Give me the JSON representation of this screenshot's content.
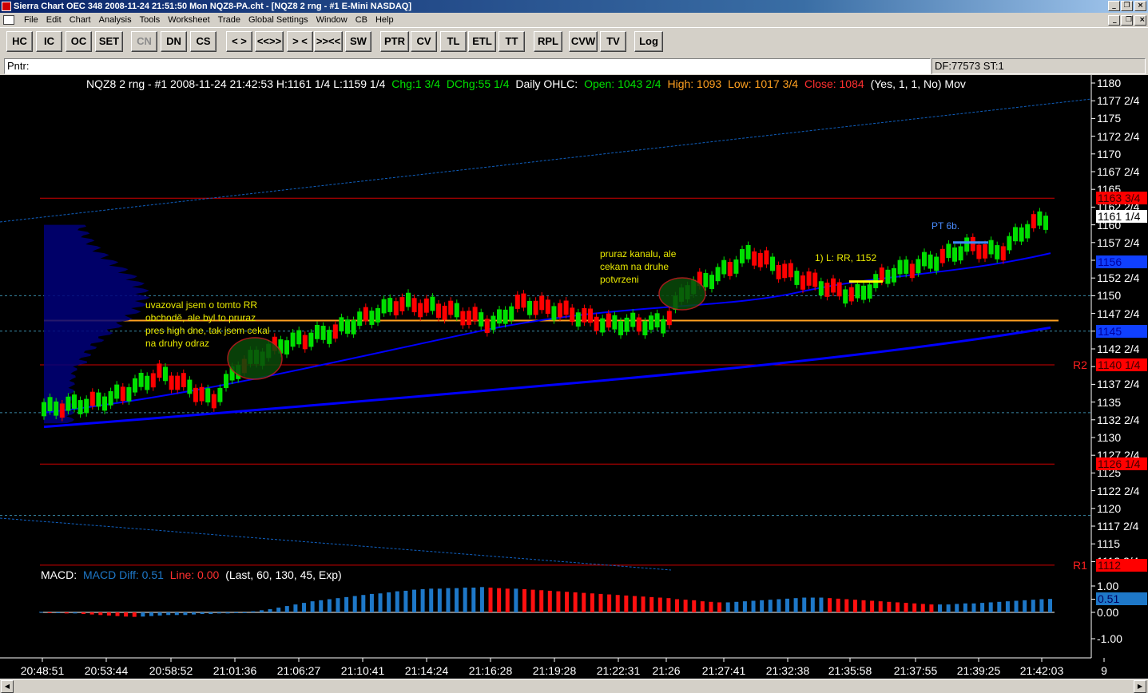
{
  "window": {
    "title": "Sierra Chart OEC 348  2008-11-24  21:51:50  Mon   NQZ8-PA.cht - [NQZ8  2 rng - #1 E-Mini NASDAQ]"
  },
  "menu": [
    "File",
    "Edit",
    "Chart",
    "Analysis",
    "Tools",
    "Worksheet",
    "Trade",
    "Global Settings",
    "Window",
    "CB",
    "Help"
  ],
  "toolbar": [
    {
      "label": "HC",
      "enabled": true
    },
    {
      "label": "IC",
      "enabled": true
    },
    {
      "label": "OC",
      "enabled": true
    },
    {
      "label": "SET",
      "enabled": true
    },
    {
      "label": "CN",
      "enabled": false
    },
    {
      "label": "DN",
      "enabled": true
    },
    {
      "label": "CS",
      "enabled": true
    },
    {
      "label": "< >",
      "enabled": true
    },
    {
      "label": "<<>>",
      "enabled": true
    },
    {
      "label": "> <",
      "enabled": true
    },
    {
      "label": ">><<",
      "enabled": true
    },
    {
      "label": "SW",
      "enabled": true
    },
    {
      "label": "PTR",
      "enabled": true
    },
    {
      "label": "CV",
      "enabled": true
    },
    {
      "label": "TL",
      "enabled": true
    },
    {
      "label": "ETL",
      "enabled": true
    },
    {
      "label": "TT",
      "enabled": true
    },
    {
      "label": "RPL",
      "enabled": true
    },
    {
      "label": "CVW",
      "enabled": true
    },
    {
      "label": "TV",
      "enabled": true
    },
    {
      "label": "Log",
      "enabled": true
    }
  ],
  "pointer": {
    "label": "Pntr:",
    "status": "DF:77573  ST:1"
  },
  "header": {
    "symbol": "NQZ8  2 rng - #1  2008-11-24  21:42:53  H:1161 1/4  L:1159 1/4",
    "chg": "Chg:1 3/4",
    "dchg": "DChg:55 1/4",
    "ohlc_label": "Daily OHLC:",
    "open": "Open: 1043 2/4",
    "high": "High: 1093",
    "low": "Low: 1017 3/4",
    "close": "Close: 1084",
    "extra": "(Yes, 1, 1, No)  Mov"
  },
  "colors": {
    "up": "#00e000",
    "down": "#ff0000",
    "ma": "#0000ff",
    "macd_blue": "#1e78c8",
    "macd_red": "#ff1010",
    "level": "#d00000",
    "orange": "#ffa020"
  },
  "price_axis": {
    "labels": [
      "1180",
      "1177 2/4",
      "1175",
      "1172 2/4",
      "1170",
      "1167 2/4",
      "1165",
      "1162 2/4",
      "1160",
      "1157 2/4",
      "1155",
      "1152 2/4",
      "1150",
      "1147 2/4",
      "1145",
      "1142 2/4",
      "1140",
      "1137 2/4",
      "1135",
      "1132 2/4",
      "1130",
      "1127 2/4",
      "1125",
      "1122 2/4",
      "1120",
      "1117 2/4",
      "1115",
      "1112 2/4"
    ],
    "tags": [
      {
        "text": "1163 3/4",
        "price": 1163.75,
        "bg": "#ff0000",
        "fg": "#400000"
      },
      {
        "text": "1161 1/4",
        "price": 1161.25,
        "bg": "#ffffff",
        "fg": "#000000"
      },
      {
        "text": "1156",
        "price": 1154.75,
        "bg": "#1040ff",
        "fg": "#0000a0"
      },
      {
        "text": "1145",
        "price": 1145.0,
        "bg": "#1040ff",
        "fg": "#0000a0"
      },
      {
        "text": "1140 1/4",
        "price": 1140.25,
        "bg": "#ff0000",
        "fg": "#400000"
      },
      {
        "text": "1126 1/4",
        "price": 1126.25,
        "bg": "#ff0000",
        "fg": "#400000"
      },
      {
        "text": "1112",
        "price": 1112.0,
        "bg": "#ff0000",
        "fg": "#400000"
      }
    ],
    "level_names": [
      {
        "text": "R2",
        "price": 1140.25
      },
      {
        "text": "R1",
        "price": 1112.0
      }
    ]
  },
  "macd_axis": {
    "labels": [
      "1.00",
      "0.50",
      "0.00",
      "-1.00"
    ],
    "tag": "0.51"
  },
  "macd": {
    "label": "MACD:",
    "diff": "MACD Diff: 0.51",
    "line": "Line: 0.00",
    "params": "(Last, 60, 130, 45, Exp)"
  },
  "time_axis": [
    "20:48:51",
    "20:53:44",
    "20:58:52",
    "21:01:36",
    "21:06:27",
    "21:10:41",
    "21:14:24",
    "21:16:28",
    "21:19:28",
    "21:22:31",
    "21:26",
    "21:27:41",
    "21:32:38",
    "21:35:58",
    "21:37:55",
    "21:39:25",
    "21:42:03",
    "9"
  ],
  "annotations": [
    {
      "text": "uvazoval jsem o tomto RR\nobchodě, ale byl to pruraz\npres high dne, tak jsem cekal\nna druhy odraz"
    },
    {
      "text": "pruraz kanalu, ale\ncekam na druhe\npotvrzeni"
    },
    {
      "text": "1) L: RR, 1152"
    },
    {
      "text": "PT 6b."
    }
  ],
  "chart_data": {
    "type": "candlestick",
    "levels": [
      1163.75,
      1140.25,
      1126.25,
      1112.0
    ],
    "dotted_levels": [
      1150.0,
      1145.0,
      1133.5,
      1119.0
    ],
    "orange_level": 1146.5,
    "macd_hist": [
      0.02,
      -0.02,
      -0.02,
      -0.04,
      -0.04,
      -0.06,
      -0.08,
      -0.1,
      -0.12,
      -0.14,
      -0.16,
      -0.17,
      -0.16,
      -0.14,
      -0.12,
      -0.1,
      -0.1,
      -0.1,
      -0.08,
      -0.06,
      -0.06,
      -0.04,
      -0.04,
      -0.02,
      0.0,
      0.04,
      0.08,
      0.12,
      0.18,
      0.24,
      0.3,
      0.36,
      0.42,
      0.46,
      0.5,
      0.54,
      0.58,
      0.62,
      0.66,
      0.7,
      0.72,
      0.76,
      0.8,
      0.82,
      0.86,
      0.88,
      0.9,
      0.9,
      0.92,
      0.92,
      0.94,
      0.94,
      0.96,
      0.94,
      0.92,
      0.9,
      0.9,
      0.88,
      0.86,
      0.84,
      0.82,
      0.8,
      0.78,
      0.76,
      0.74,
      0.72,
      0.7,
      0.68,
      0.66,
      0.64,
      0.62,
      0.6,
      0.58,
      0.56,
      0.54,
      0.5,
      0.48,
      0.46,
      0.42,
      0.4,
      0.38,
      0.38,
      0.4,
      0.42,
      0.44,
      0.46,
      0.48,
      0.5,
      0.52,
      0.54,
      0.56,
      0.56,
      0.56,
      0.54,
      0.52,
      0.5,
      0.48,
      0.46,
      0.44,
      0.42,
      0.4,
      0.38,
      0.36,
      0.34,
      0.32,
      0.3,
      0.3,
      0.3,
      0.32,
      0.34,
      0.34,
      0.36,
      0.38,
      0.4,
      0.42,
      0.44,
      0.46,
      0.48,
      0.5,
      0.51
    ]
  }
}
